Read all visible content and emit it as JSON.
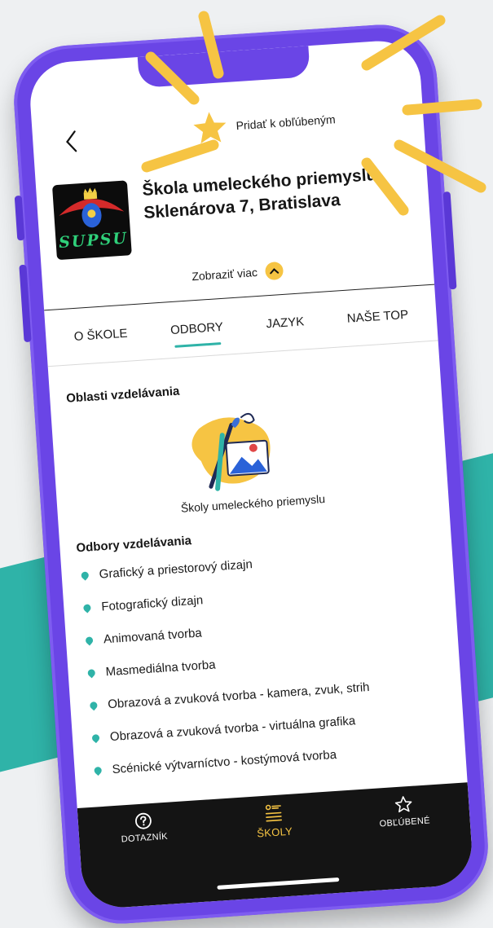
{
  "header": {
    "favorite_label": "Pridať k obľúbeným"
  },
  "school": {
    "logo_text": "SUPSU",
    "name": "Škola umeleckého priemyslu, Sklenárova 7, Bratislava",
    "show_more_label": "Zobraziť viac"
  },
  "tabs": [
    {
      "label": "O ŠKOLE",
      "active": false
    },
    {
      "label": "ODBORY",
      "active": true
    },
    {
      "label": "JAZYK",
      "active": false
    },
    {
      "label": "NAŠE TOP",
      "active": false
    }
  ],
  "areas": {
    "title": "Oblasti vzdelávania",
    "caption": "Školy umeleckého priemyslu"
  },
  "fields": {
    "title": "Odbory vzdelávania",
    "items": [
      "Grafický a priestorový dizajn",
      "Fotografický dizajn",
      "Animovaná tvorba",
      "Masmediálna tvorba",
      "Obrazová a zvuková tvorba - kamera, zvuk, strih",
      "Obrazová a zvuková tvorba - virtuálna grafika",
      "Scénické výtvarníctvo - kostýmová tvorba"
    ]
  },
  "bottom_nav": [
    {
      "label": "DOTAZNÍK",
      "icon": "question-icon",
      "active": false
    },
    {
      "label": "ŠKOLY",
      "icon": "list-icon",
      "active": true
    },
    {
      "label": "OBĽÚBENÉ",
      "icon": "star-icon",
      "active": false
    }
  ],
  "colors": {
    "phone": "#6a45e6",
    "accent_teal": "#2fb3a8",
    "accent_yellow": "#f6c443",
    "nav_bg": "#141414"
  }
}
